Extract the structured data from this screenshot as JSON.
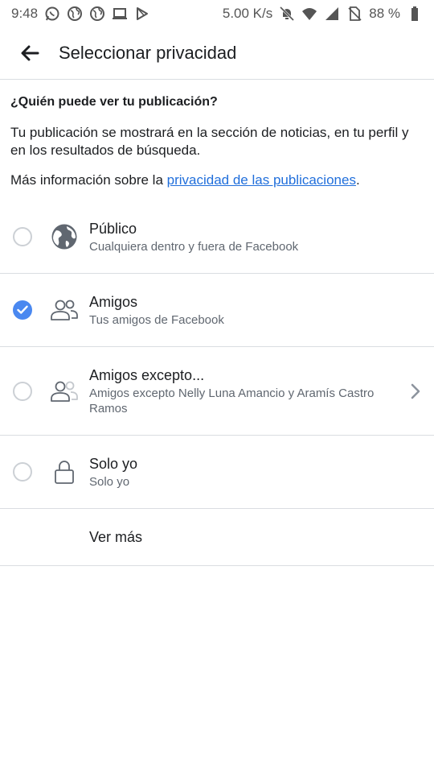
{
  "status_bar": {
    "time": "9:48",
    "left_icons": [
      "whatsapp-icon",
      "globe-icon",
      "globe-icon",
      "laptop-icon",
      "play-store-icon"
    ],
    "network_speed": "5.00 K/s",
    "right_icons": [
      "bell-off-icon",
      "wifi-icon",
      "signal-icon",
      "no-sim-icon"
    ],
    "battery": "88 %"
  },
  "header": {
    "title": "Seleccionar privacidad"
  },
  "intro": {
    "question": "¿Quién puede ver tu publicación?",
    "description": "Tu publicación se mostrará en la sección de noticias, en tu perfil y en los resultados de búsqueda.",
    "more_info_prefix": "Más información sobre la ",
    "more_info_link": "privacidad de las publicaciones",
    "more_info_suffix": "."
  },
  "options": [
    {
      "title": "Público",
      "subtitle": "Cualquiera dentro y fuera de Facebook",
      "icon": "globe-icon",
      "selected": false
    },
    {
      "title": "Amigos",
      "subtitle": "Tus amigos de Facebook",
      "icon": "friends-icon",
      "selected": true
    },
    {
      "title": "Amigos excepto...",
      "subtitle": "Amigos excepto Nelly Luna Amancio y Aramís Castro Ramos",
      "icon": "friends-except-icon",
      "selected": false
    },
    {
      "title": "Solo yo",
      "subtitle": "Solo yo",
      "icon": "lock-icon",
      "selected": false
    }
  ],
  "see_more": "Ver más",
  "colors": {
    "accent": "#4a88f0",
    "link": "#216fdb",
    "divider": "#dadde1"
  }
}
